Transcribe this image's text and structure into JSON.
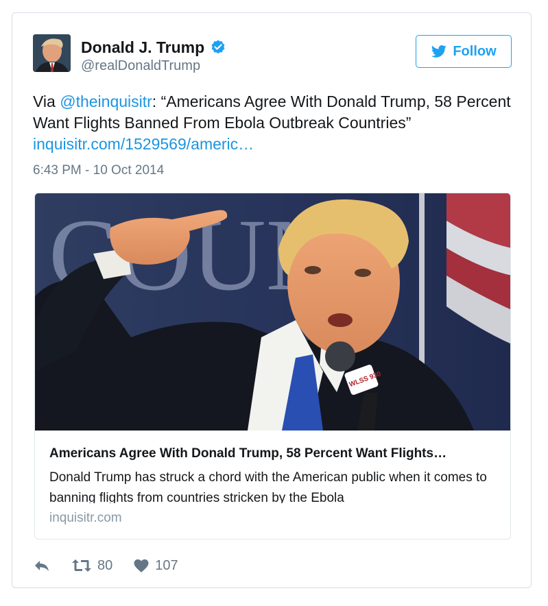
{
  "tweet": {
    "author_name": "Donald J. Trump",
    "author_handle": "@realDonaldTrump",
    "follow_label": "Follow",
    "text_prefix": "Via ",
    "mention": "@theinquisitr",
    "text_quote": ": “Americans Agree With Donald Trump, 58 Percent Want Flights Banned From Ebola Outbreak Countries”",
    "link_text": "inquisitr.com/1529569/americ…",
    "timestamp": "6:43 PM - 10 Oct 2014"
  },
  "card": {
    "title": "Americans Agree With Donald Trump, 58 Percent Want Flights…",
    "description": "Donald Trump has struck a chord with the American public when it comes to banning flights from countries stricken by the Ebola",
    "domain": "inquisitr.com",
    "image_sign_text": "COUN",
    "mic_label": "WLSS 930"
  },
  "actions": {
    "retweet_count": "80",
    "like_count": "107"
  },
  "colors": {
    "accent": "#1da1f2",
    "link": "#1b95e0",
    "muted": "#657786"
  },
  "icons": {
    "verified": "verified-badge-icon",
    "follow": "twitter-bird-icon",
    "reply": "reply-icon",
    "retweet": "retweet-icon",
    "like": "heart-icon"
  }
}
